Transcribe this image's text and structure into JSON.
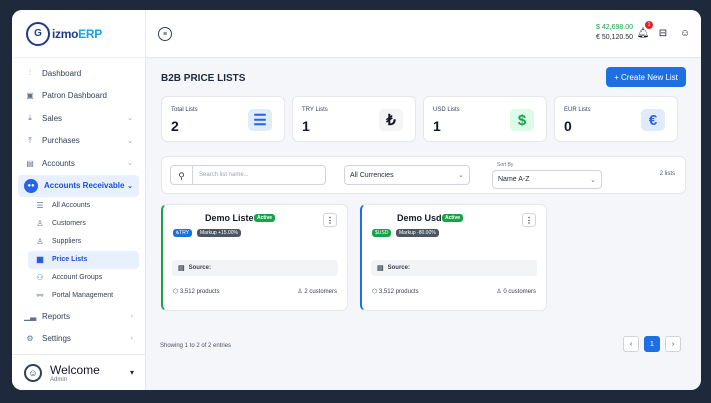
{
  "app": {
    "logo_mark": "G",
    "logo_text_a": "izmo",
    "logo_text_b": "ERP"
  },
  "sidebar": {
    "items": [
      {
        "label": "Dashboard",
        "icon": "chart-icon"
      },
      {
        "label": "Patron Dashboard",
        "icon": "square-icon"
      },
      {
        "label": "Sales",
        "icon": "download-icon"
      },
      {
        "label": "Purchases",
        "icon": "upload-icon"
      },
      {
        "label": "Accounts",
        "icon": "ledger-icon"
      },
      {
        "label": "Accounts Receivable",
        "icon": "users-icon"
      }
    ],
    "sub_items": [
      {
        "label": "All Accounts"
      },
      {
        "label": "Customers"
      },
      {
        "label": "Suppliers"
      },
      {
        "label": "Price Lists"
      },
      {
        "label": "Account Groups"
      },
      {
        "label": "Portal Management"
      }
    ],
    "bottom_items": [
      {
        "label": "Reports"
      },
      {
        "label": "Settings"
      }
    ],
    "welcome": "Welcome",
    "role": "Admin"
  },
  "topbar": {
    "balance_usd": "$ 42,698.00",
    "balance_eur": "€ 50,120.50",
    "notification_count": "1"
  },
  "page": {
    "title": "B2B PRICE LISTS",
    "create_label": "+ Create New List"
  },
  "stats": [
    {
      "label": "Total Lists",
      "value": "2",
      "icon": "☰",
      "color": "#2563eb",
      "bg": "#e0ebfd"
    },
    {
      "label": "TRY Lists",
      "value": "1",
      "icon": "₺",
      "color": "#111827",
      "bg": "#f3f4f6"
    },
    {
      "label": "USD Lists",
      "value": "1",
      "icon": "$",
      "color": "#16a34a",
      "bg": "#dcfce7"
    },
    {
      "label": "EUR Lists",
      "value": "0",
      "icon": "€",
      "color": "#2563eb",
      "bg": "#e0ebfd"
    }
  ],
  "filter": {
    "search_placeholder": "Search list name...",
    "currency": "All Currencies",
    "sort_label": "Sort By",
    "sort": "Name A-Z",
    "count": "2 lists"
  },
  "cards": [
    {
      "name": "Demo Liste",
      "status": "Active",
      "currency": "₺TRY",
      "markup": "Markup +15.00%",
      "source_label": "Source:",
      "products": "3,512 products",
      "customers": "2 customers",
      "accent": "#16a34a",
      "cur_bg": "#1d6fe6"
    },
    {
      "name": "Demo Usd",
      "status": "Active",
      "currency": "$USD",
      "markup": "Markup -80.00%",
      "source_label": "Source:",
      "products": "3,512 products",
      "customers": "0 customers",
      "accent": "#1d6fe6",
      "cur_bg": "#16a34a"
    }
  ],
  "footer": {
    "showing": "Showing 1 to 2 of 2 entries",
    "prev": "‹",
    "page": "1",
    "next": "›"
  }
}
